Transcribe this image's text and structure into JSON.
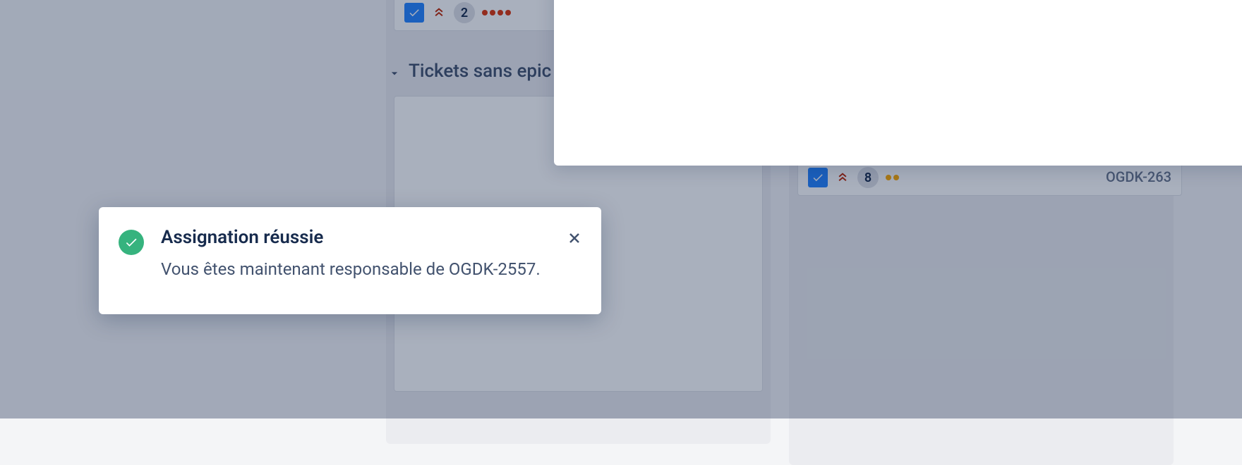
{
  "section": {
    "header": "Tickets sans epic"
  },
  "cards": {
    "card1": {
      "storyPoints": "2",
      "dotColor": "red",
      "dotCount": 4
    },
    "card2": {
      "storyPoints": "8",
      "dotColor": "yellow",
      "dotCount": 2,
      "key": "OGDK-263"
    }
  },
  "toast": {
    "title": "Assignation réussie",
    "message": "Vous êtes maintenant responsable de OGDK-2557."
  }
}
